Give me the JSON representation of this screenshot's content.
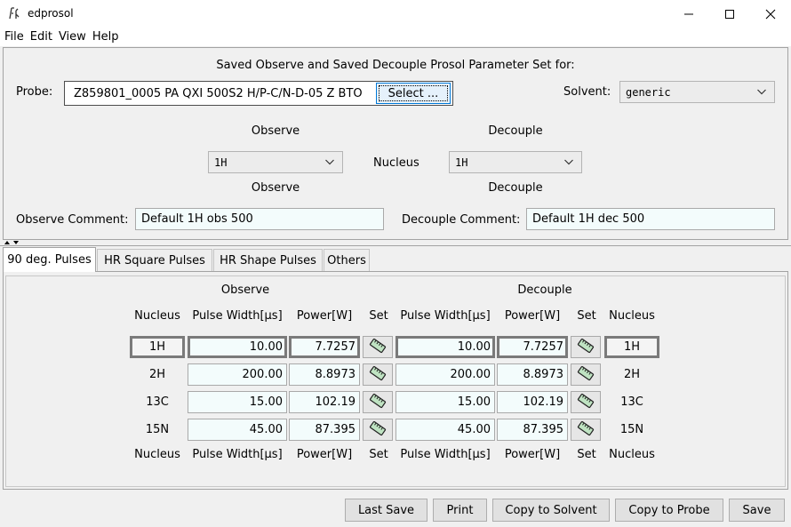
{
  "window": {
    "title": "edprosol",
    "icon": "edprosol-app-icon",
    "controls": [
      "minimize",
      "maximize",
      "close"
    ]
  },
  "menu": [
    "File",
    "Edit",
    "View",
    "Help"
  ],
  "header": {
    "heading": "Saved Observe and Saved Decouple Prosol Parameter Set for:",
    "probe_label": "Probe:",
    "probe_value": "Z859801_0005  PA QXI 500S2 H/P-C/N-D-05 Z BTO",
    "select_button": "Select ...",
    "solvent_label": "Solvent:",
    "solvent_value": "generic",
    "observe_title": "Observe",
    "decouple_title": "Decouple",
    "nucleus_label": "Nucleus",
    "observe_nucleus": "1H",
    "decouple_nucleus": "1H",
    "observe_subtitle": "Observe",
    "decouple_subtitle": "Decouple",
    "observe_comment_label": "Observe Comment:",
    "observe_comment": "Default 1H obs 500",
    "decouple_comment_label": "Decouple Comment:",
    "decouple_comment": "Default 1H dec 500"
  },
  "tabs": [
    {
      "label": "90 deg. Pulses",
      "active": true
    },
    {
      "label": "HR  Square Pulses",
      "active": false
    },
    {
      "label": "HR  Shape Pulses",
      "active": false
    },
    {
      "label": "Others",
      "active": false
    }
  ],
  "table": {
    "observe_title": "Observe",
    "decouple_title": "Decouple",
    "columns": [
      "Nucleus",
      "Pulse Width[µs]",
      "Power[W]",
      "Set",
      "Pulse Width[µs]",
      "Power[W]",
      "Set",
      "Nucleus"
    ],
    "rows": [
      {
        "nucleus": "1H",
        "obs_pw": "10.00",
        "obs_power": "7.7257",
        "dec_pw": "10.00",
        "dec_power": "7.7257",
        "dec_nucleus": "1H",
        "selected": true
      },
      {
        "nucleus": "2H",
        "obs_pw": "200.00",
        "obs_power": "8.8973",
        "dec_pw": "200.00",
        "dec_power": "8.8973",
        "dec_nucleus": "2H",
        "selected": false
      },
      {
        "nucleus": "13C",
        "obs_pw": "15.00",
        "obs_power": "102.19",
        "dec_pw": "15.00",
        "dec_power": "102.19",
        "dec_nucleus": "13C",
        "selected": false
      },
      {
        "nucleus": "15N",
        "obs_pw": "45.00",
        "obs_power": "87.395",
        "dec_pw": "45.00",
        "dec_power": "87.395",
        "dec_nucleus": "15N",
        "selected": false
      }
    ],
    "set_icon": "ruler-icon"
  },
  "buttons": {
    "last_save": "Last Save",
    "print": "Print",
    "copy_to_solvent": "Copy to Solvent",
    "copy_to_probe": "Copy to Probe",
    "save": "Save"
  }
}
